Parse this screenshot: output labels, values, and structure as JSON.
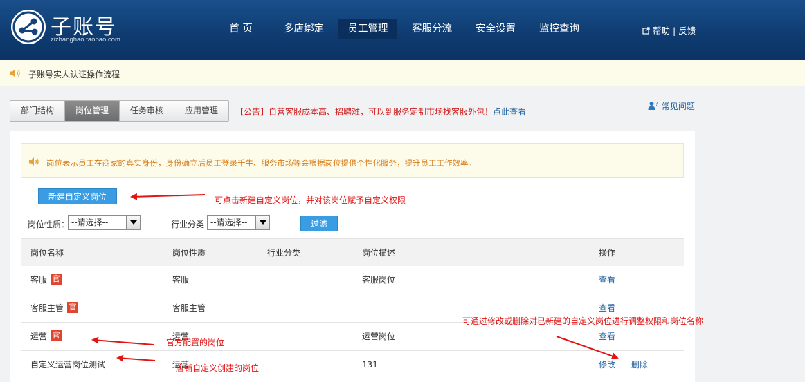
{
  "header": {
    "logo_title": "子账号",
    "logo_sub": "zizhanghao.taobao.com",
    "nav": [
      "首 页",
      "多店绑定",
      "员工管理",
      "客服分流",
      "安全设置",
      "监控查询"
    ],
    "active_nav": "员工管理",
    "help": "帮助",
    "separator": "|",
    "feedback": "反馈"
  },
  "notice_bar": {
    "text": "子账号实人认证操作流程"
  },
  "tabs": [
    "部门结构",
    "岗位管理",
    "任务审核",
    "应用管理"
  ],
  "active_tab": "岗位管理",
  "announcement": {
    "prefix": "【公告】自营客服成本高、招聘难，可以到服务定制市场找客服外包！",
    "link": "点此查看"
  },
  "faq": "常见问题",
  "tip": {
    "text": "岗位表示员工在商家的真实身份，身份确立后员工登录千牛、服务市场等会根据岗位提供个性化服务，提升员工工作效率。"
  },
  "buttons": {
    "new_role": "新建自定义岗位",
    "filter": "过滤"
  },
  "filters": {
    "nature_label": "岗位性质：",
    "nature_value": "--请选择--",
    "industry_label": "行业分类",
    "industry_value": "--请选择--"
  },
  "table": {
    "headers": [
      "岗位名称",
      "岗位性质",
      "行业分类",
      "岗位描述",
      "操作"
    ],
    "official_badge": "官",
    "rows": [
      {
        "name": "客服",
        "nature": "客服",
        "industry": "",
        "desc": "客服岗位",
        "ops": [
          "查看"
        ]
      },
      {
        "name": "客服主管",
        "nature": "客服主管",
        "industry": "",
        "desc": "",
        "ops": [
          "查看"
        ]
      },
      {
        "name": "运营",
        "nature": "运营",
        "industry": "",
        "desc": "运营岗位",
        "ops": [
          "查看"
        ]
      },
      {
        "name": "自定义运营岗位测试",
        "nature": "运营",
        "industry": "",
        "desc": "131",
        "ops": [
          "修改",
          "删除"
        ]
      }
    ]
  },
  "annotations": {
    "new_role_note": "可点击新建自定义岗位，并对该岗位赋予自定义权限",
    "official_note": "官方配置的岗位",
    "custom_note": "店铺自定义创建的岗位",
    "edit_note": "可通过修改或删除对已新建的自定义岗位进行调整权限和岗位名称"
  },
  "colors": {
    "header": "#124581",
    "accent": "#3a9de3",
    "badge": "#e0452f",
    "annotation": "#e21414",
    "link": "#1f5f9e"
  }
}
